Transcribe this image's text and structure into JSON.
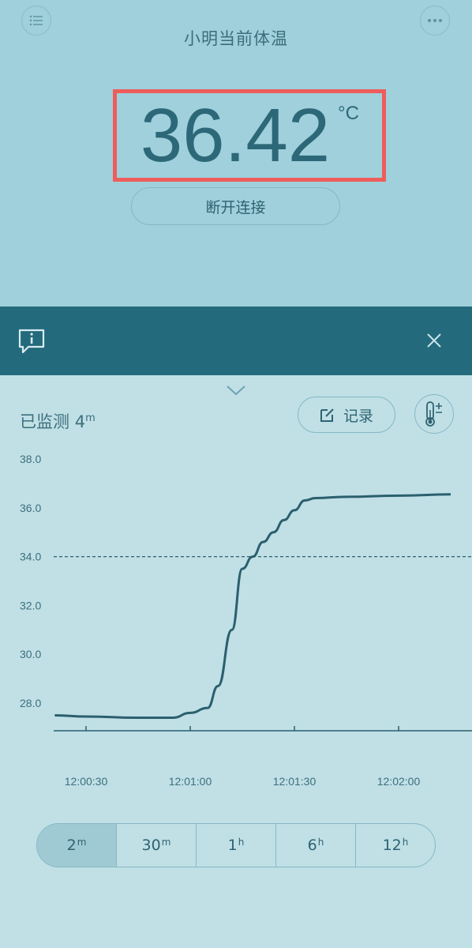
{
  "header": {
    "title": "小明当前体温",
    "menu_icon": "list-icon",
    "more_icon": "more-icon"
  },
  "temperature": {
    "value": "36.42",
    "unit": "°C"
  },
  "disconnect_label": "断开连接",
  "banner": {
    "info_icon": "info-message-icon",
    "close_icon": "close-icon"
  },
  "monitor": {
    "label": "已监测",
    "duration_value": "4",
    "duration_unit": "m"
  },
  "record_label": "记录",
  "range_options": [
    {
      "value": "2",
      "unit": "m",
      "selected": true
    },
    {
      "value": "30",
      "unit": "m",
      "selected": false
    },
    {
      "value": "1",
      "unit": "h",
      "selected": false
    },
    {
      "value": "6",
      "unit": "h",
      "selected": false
    },
    {
      "value": "12",
      "unit": "h",
      "selected": false
    }
  ],
  "colors": {
    "accent": "#246a7d",
    "highlight_border": "#ee5d5b",
    "line": "#2b5f6e"
  },
  "chart_data": {
    "type": "line",
    "title": "",
    "xlabel": "",
    "ylabel": "",
    "ylim": [
      27,
      38
    ],
    "y_ticks": [
      "38.0",
      "36.0",
      "34.0",
      "32.0",
      "30.0",
      "28.0"
    ],
    "x_ticks": [
      "12:00:30",
      "12:01:00",
      "12:01:30",
      "12:02:00"
    ],
    "threshold": 34.0,
    "series": [
      {
        "x": [
          "12:00:21",
          "12:00:30",
          "12:00:45",
          "12:00:55",
          "12:01:00",
          "12:01:05",
          "12:01:08",
          "12:01:12",
          "12:01:15",
          "12:01:18",
          "12:01:21",
          "12:01:24",
          "12:01:27",
          "12:01:30",
          "12:01:33",
          "12:01:36",
          "12:01:45",
          "12:02:00",
          "12:02:15"
        ],
        "values": [
          27.5,
          27.45,
          27.4,
          27.4,
          27.6,
          27.8,
          28.7,
          31.0,
          33.5,
          34.0,
          34.6,
          35.0,
          35.5,
          35.9,
          36.3,
          36.4,
          36.45,
          36.5,
          36.55
        ]
      }
    ],
    "grid": false,
    "legend": "none"
  }
}
